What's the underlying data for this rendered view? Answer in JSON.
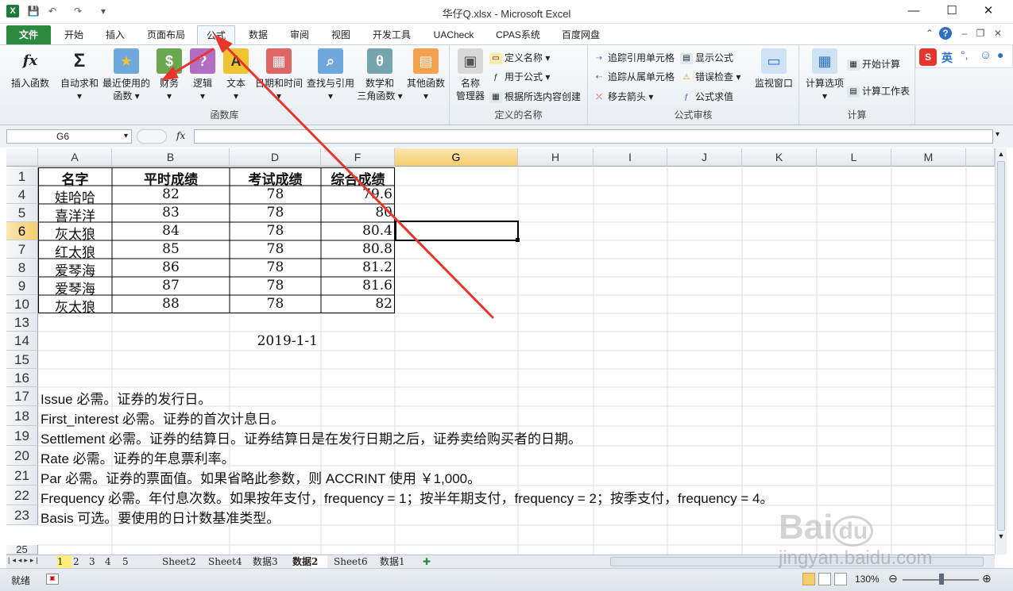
{
  "window": {
    "title": "华仔Q.xlsx - Microsoft Excel",
    "minimize": "—",
    "maximize": "☐",
    "close": "✕"
  },
  "tabs": [
    "文件",
    "开始",
    "插入",
    "页面布局",
    "公式",
    "数据",
    "审阅",
    "视图",
    "开发工具",
    "UACheck",
    "CPAS系统",
    "百度网盘"
  ],
  "active_tab": "公式",
  "ribbon": {
    "function_library": {
      "label": "函数库",
      "buttons": [
        {
          "line1": "插入函数",
          "line2": "",
          "icon": "fx-icon"
        },
        {
          "line1": "自动求和",
          "line2": "▾",
          "icon": "sigma-icon"
        },
        {
          "line1": "最近使用的",
          "line2": "函数 ▾",
          "icon": "star-book-icon"
        },
        {
          "line1": "财务",
          "line2": "▾",
          "icon": "finance-book-icon"
        },
        {
          "line1": "逻辑",
          "line2": "▾",
          "icon": "logic-book-icon"
        },
        {
          "line1": "文本",
          "line2": "▾",
          "icon": "text-book-icon"
        },
        {
          "line1": "日期和时间",
          "line2": "▾",
          "icon": "date-book-icon"
        },
        {
          "line1": "查找与引用",
          "line2": "▾",
          "icon": "lookup-book-icon"
        },
        {
          "line1": "数学和",
          "line2": "三角函数 ▾",
          "icon": "math-book-icon"
        },
        {
          "line1": "其他函数",
          "line2": "▾",
          "icon": "more-book-icon"
        }
      ]
    },
    "defined_names": {
      "label": "定义的名称",
      "manager_line1": "名称",
      "manager_line2": "管理器",
      "items": [
        "定义名称 ▾",
        "用于公式 ▾",
        "根据所选内容创建"
      ]
    },
    "formula_auditing": {
      "label": "公式审核",
      "items": [
        "追踪引用单元格",
        "追踪从属单元格",
        "移去箭头 ▾",
        "显示公式",
        "错误检查 ▾",
        "公式求值"
      ],
      "watch": "监视窗口"
    },
    "calculation": {
      "label": "计算",
      "options_line1": "计算选项",
      "options_line2": "▾",
      "items": [
        "开始计算",
        "计算工作表"
      ]
    }
  },
  "ime": {
    "logo": "S",
    "mode": "英"
  },
  "formula_bar": {
    "name_box": "G6",
    "fx": "fx",
    "content": ""
  },
  "grid": {
    "columns": [
      "A",
      "B",
      "D",
      "F",
      "G",
      "H",
      "I",
      "J",
      "K",
      "L",
      "M"
    ],
    "selected_column": "G",
    "rows": [
      "1",
      "4",
      "5",
      "6",
      "7",
      "8",
      "9",
      "10",
      "13",
      "14",
      "15",
      "16",
      "17",
      "18",
      "19",
      "20",
      "21",
      "22",
      "23",
      "25"
    ],
    "selected_row": "6",
    "header": [
      "名字",
      "平时成绩",
      "考试成绩",
      "综合成绩"
    ],
    "table": [
      [
        "娃哈哈",
        "82",
        "78",
        "79.6"
      ],
      [
        "喜洋洋",
        "83",
        "78",
        "80"
      ],
      [
        "灰太狼",
        "84",
        "78",
        "80.4"
      ],
      [
        "红太狼",
        "85",
        "78",
        "80.8"
      ],
      [
        "爱琴海",
        "86",
        "78",
        "81.2"
      ],
      [
        "爱琴海",
        "87",
        "78",
        "81.6"
      ],
      [
        "灰太狼",
        "88",
        "78",
        "82"
      ]
    ],
    "date_cell": "2019-1-1",
    "notes": [
      "Issue 必需。证券的发行日。",
      "First_interest 必需。证券的首次计息日。",
      "Settlement 必需。证券的结算日。证券结算日是在发行日期之后，证券卖给购买者的日期。",
      "Rate 必需。证券的年息票利率。",
      "Par 必需。证券的票面值。如果省略此参数，则 ACCRINT 使用 ￥1,000。",
      "Frequency 必需。年付息次数。如果按年支付，frequency = 1；按半年期支付，frequency = 2；按季支付，frequency = 4。",
      "Basis 可选。要使用的日计数基准类型。"
    ]
  },
  "sheets": [
    "1",
    "2",
    "3",
    "4",
    "5",
    "Sheet2",
    "Sheet4",
    "数据3",
    "数据2",
    "Sheet6",
    "数据1"
  ],
  "active_sheet": "数据2",
  "status": {
    "ready": "就绪",
    "zoom": "130%"
  },
  "watermark": "jingyan.baidu.com",
  "colors": {
    "arrow": "#e8352b",
    "file_tab": "#2b8a3e",
    "selection": "#000000"
  }
}
